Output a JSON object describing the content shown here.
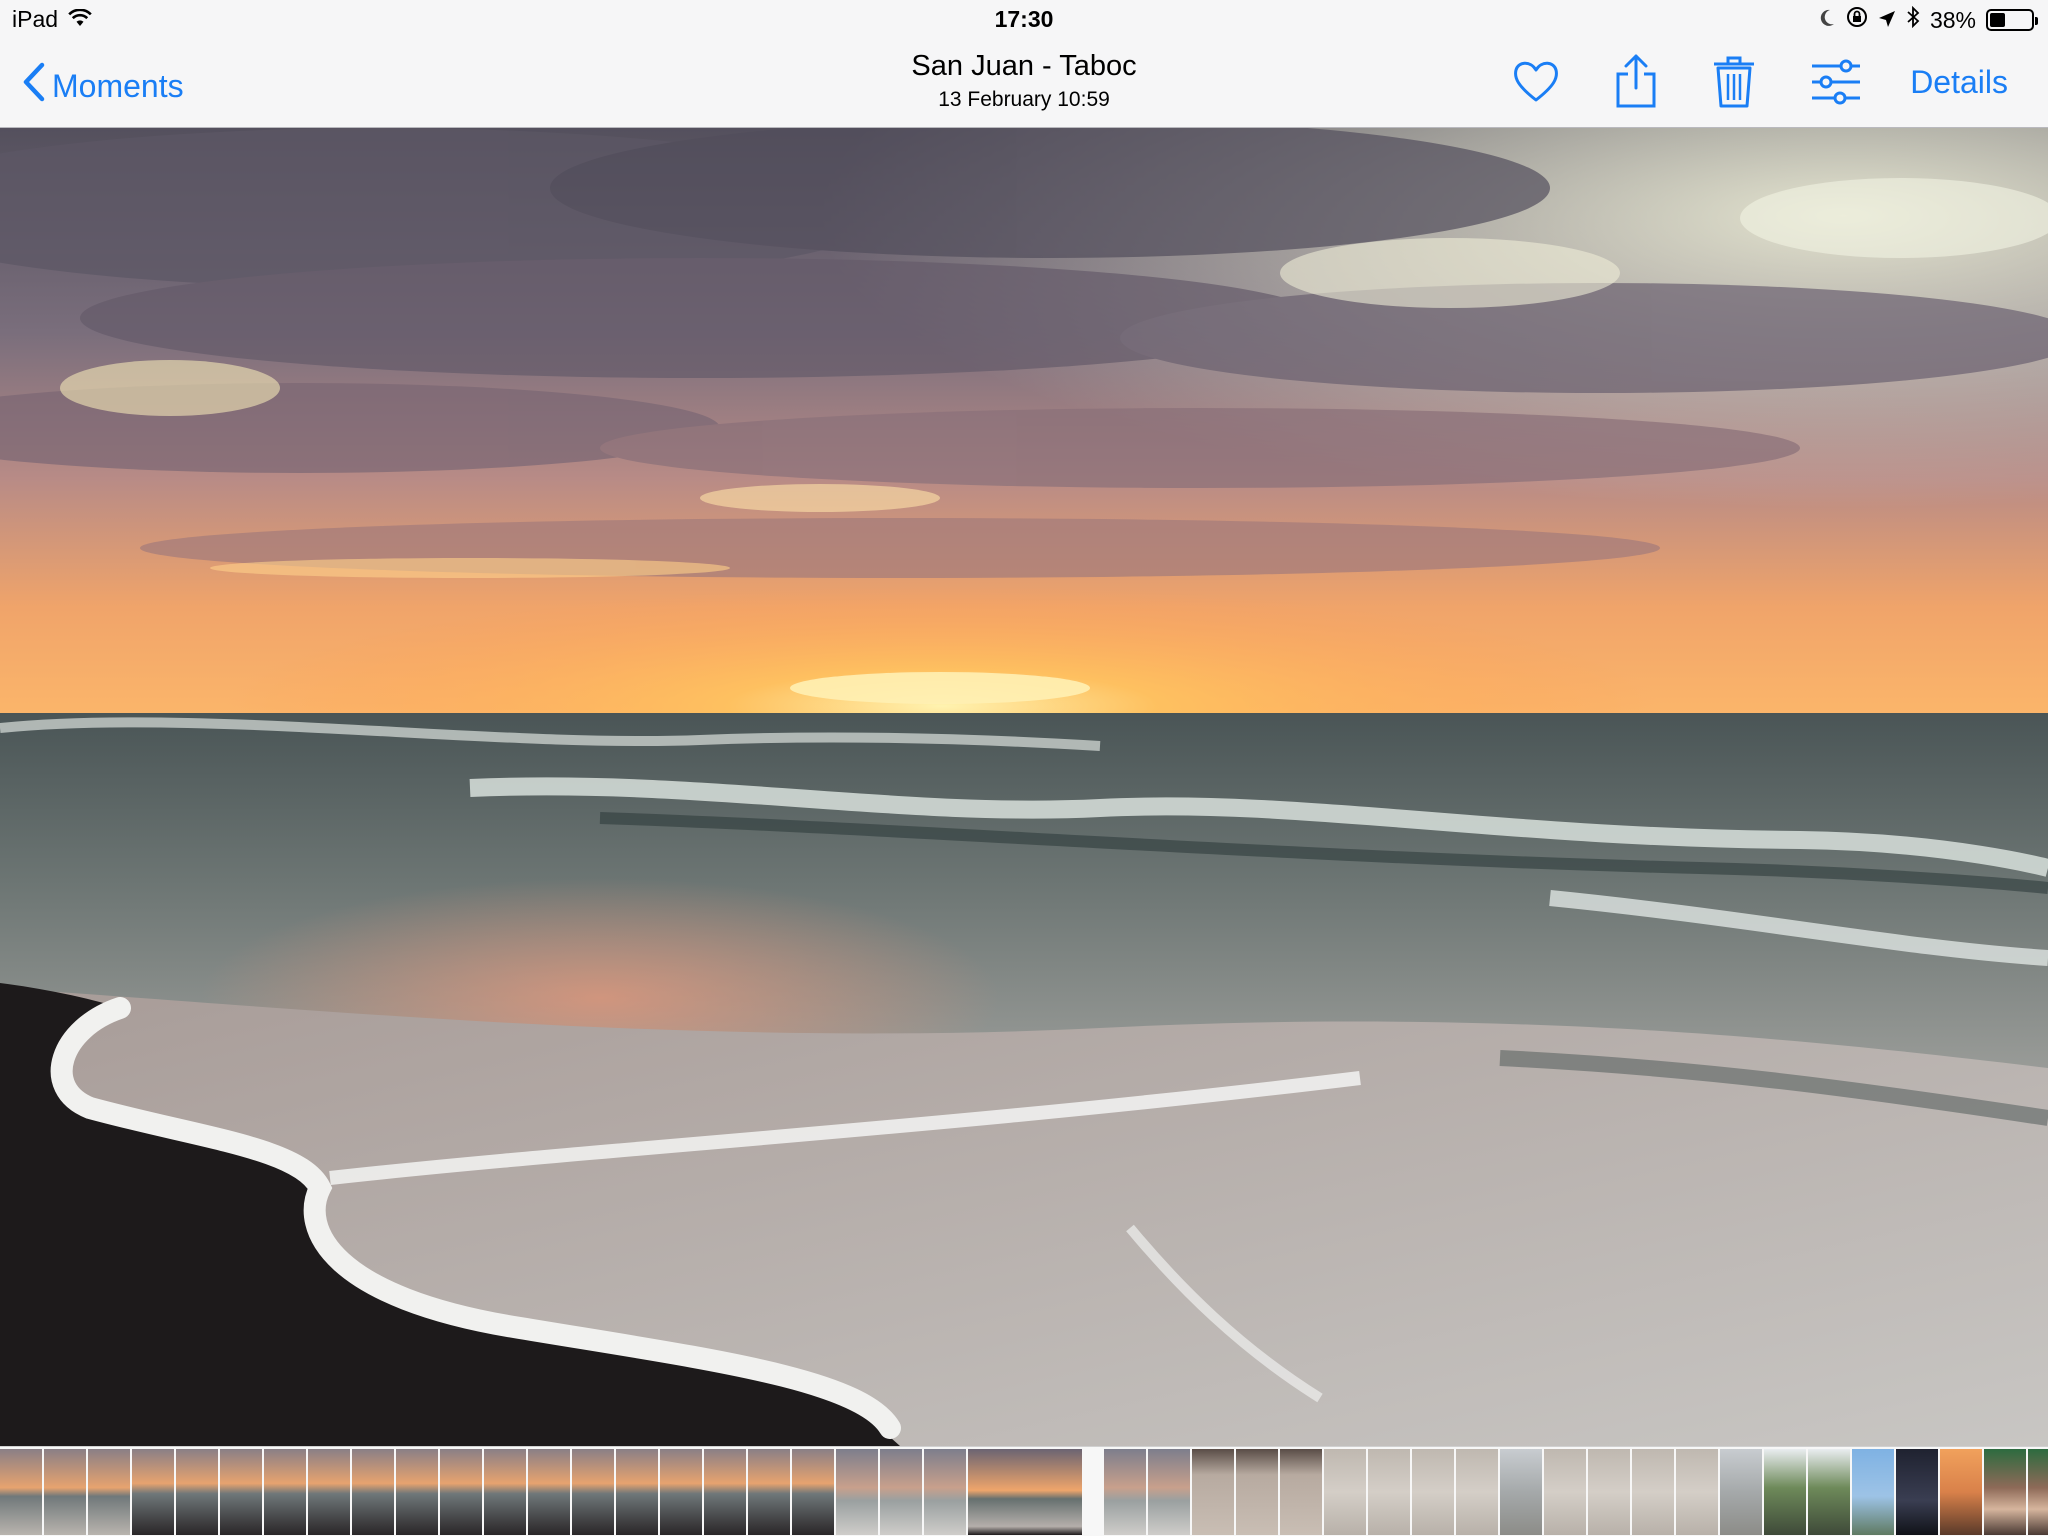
{
  "status_bar": {
    "device": "iPad",
    "time": "17:30",
    "battery_text": "38%",
    "battery_level": 0.38
  },
  "nav": {
    "back_label": "Moments",
    "title": "San Juan - Taboc",
    "subtitle": "13 February  10:59",
    "details_label": "Details"
  },
  "icons": [
    "wifi-icon",
    "moon-icon",
    "orientation-lock-icon",
    "location-arrow-icon",
    "bluetooth-icon",
    "battery-icon",
    "chevron-left-icon",
    "heart-icon",
    "share-icon",
    "trash-icon",
    "edit-sliders-icon"
  ],
  "colors": {
    "accent": "#1a7ef5",
    "bar": "#f6f6f7"
  },
  "filmstrip": {
    "thumbnails": [
      "beach-sunset",
      "beach-sunset",
      "beach-sunset",
      "beach-person",
      "beach-person",
      "beach-person",
      "beach-person",
      "beach-person",
      "beach-person",
      "beach-person",
      "beach-person",
      "beach-person",
      "beach-person",
      "beach-person",
      "beach-person",
      "beach-person",
      "beach-person",
      "beach-person",
      "beach-person",
      "beach-dusk",
      "beach-dusk",
      "beach-dusk",
      "current-sunset",
      "beach-dusk",
      "beach-dusk",
      "feet-sand",
      "feet-sand",
      "feet-sand",
      "sand-writing",
      "sand-writing",
      "sand-writing",
      "sand-writing",
      "beach-grey",
      "sand-writing",
      "sand-writing",
      "sand-writing",
      "sand-writing",
      "beach-grey",
      "palm-trees",
      "palm-trees",
      "blue-sky",
      "dark-sunset",
      "orange-sky",
      "people-group",
      "people-group",
      "people-group"
    ]
  }
}
